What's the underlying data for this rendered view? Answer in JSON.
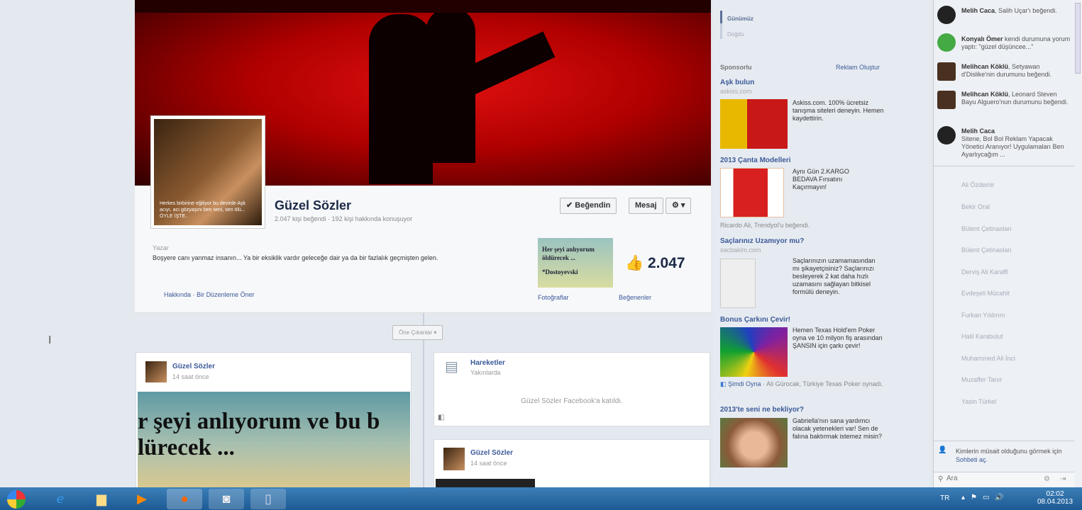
{
  "nav": {
    "items": [
      {
        "label": "Günümüz"
      },
      {
        "label": "Doğdu"
      }
    ]
  },
  "page": {
    "title": "Güzel Sözler",
    "subtitle": "2.047 kişi beğendi · 192 kişi hakkında konuşuyor",
    "profile_caption": "Herkes birbirine eğiliyor bu devirde Aşk acıyı, acı gözyaşını ben seni, sen ölü... ÖYLE İŞTE..",
    "buttons": {
      "like": "✔ Beğendin",
      "message": "Mesaj",
      "settings": "⚙ ▾"
    },
    "category": "Yazar",
    "about": "Boşyere canı yanmaz insanın... Ya bir eksiklik vardır geleceğe dair ya da bir fazlalık geçmişten gelen.",
    "links": {
      "about": "Hakkında",
      "separator": "·",
      "suggest": "Bir Düzenleme Öner"
    },
    "photo_caption": [
      "Her şeyi anlıyorum",
      "öldürecek ...",
      "*Dostoyevski"
    ],
    "likes_count": "2.047",
    "photos_label": "Fotoğraflar",
    "likers_label": "Beğenenler"
  },
  "timeline": {
    "highlights": "Öne Çıkanlar ▾",
    "post1": {
      "author": "Güzel Sözler",
      "time": "14 saat önce",
      "image_text": [
        "r şeyi anlıyorum ve bu b",
        "lürecek ..."
      ]
    },
    "activity": {
      "title": "Hareketler",
      "subtitle": "Yakınlarda",
      "text": "Güzel Sözler Facebook'a katıldı."
    },
    "post2": {
      "author": "Güzel Sözler",
      "time": "14 saat önce"
    }
  },
  "sponsored": {
    "label": "Sponsorlu",
    "create": "Reklam Oluştur",
    "ads": [
      {
        "title": "Aşk bulun",
        "domain": "askiss.com",
        "text": "Askiss.com. 100% ücretsiz tanışma siteleri deneyin. Hemen kaydettirin."
      },
      {
        "title": "2013 Çanta Modelleri",
        "text": "Aynı Gün 2.KARGO BEDAVA Fırsatını Kaçırmayın!",
        "social": "Ricardo Ali, Trendyol'u beğendi."
      },
      {
        "title": "Saçlarınız Uzamıyor mu?",
        "domain": "sacbakim.com",
        "text": "Saçlarınızın uzamamasından mı şikayetçisiniz? Saçlarınızı besleyerek 2 kat daha hızlı uzamasını sağlayan bitkisel formülü deneyin."
      },
      {
        "title": "Bonus Çarkını Çevir!",
        "text": "Hemen Texas Hold'em Poker oyna ve 10 milyon fiş arasından ŞANSIN için çarkı çevir!",
        "play": "Şimdi Oyna",
        "social": " · Ali Gürocak, Türkiye Texas Poker oynadı."
      },
      {
        "title": "2013'te seni ne bekliyor?",
        "text": "Gabriella'nın sana yardımcı olacak yetenekleri var! Sen de falına baktırmak istemez misin?"
      }
    ]
  },
  "ticker": [
    {
      "name": "Melih Caca",
      "text": ", Salih Uçar'ı beğendi."
    },
    {
      "name": "Konyalı Ömer",
      "text": " kendi durumuna yorum yaptı: \"güzel düşüncee...\""
    },
    {
      "name": "Melihcan Köklü",
      "text": ", Setyawan d'Dislike'nin durumunu beğendi."
    },
    {
      "name": "Melihcan Köklü",
      "text": ", Leonard Steven Bayu Alguero'nun durumunu beğendi."
    },
    {
      "name": "Melih Caca",
      "text": " Sitene, Bol Bol Reklam Yapacak Yönetici Aranıyor! Uygulamaları Ben Ayarlıycağım ..."
    }
  ],
  "friends": [
    "Ali Özdemir",
    "Bekir Oral",
    "Bülent Çetinaslan",
    "Bülent Çetinaslan",
    "Derviş Ali Karaffi",
    "Evdeşeli Mücahit",
    "Furkan Yıldırım",
    "Halil Karabulut",
    "Muhammed Ali İnci",
    "Muzaffer Tanır",
    "Yasin Türkel"
  ],
  "chat": {
    "notice": "Kimlerin müsait olduğunu görmek için ",
    "notice_link": "Sohbeti aç.",
    "search_placeholder": "Ara"
  },
  "taskbar": {
    "lang": "TR",
    "time": "02:02",
    "date": "08.04.2013"
  }
}
